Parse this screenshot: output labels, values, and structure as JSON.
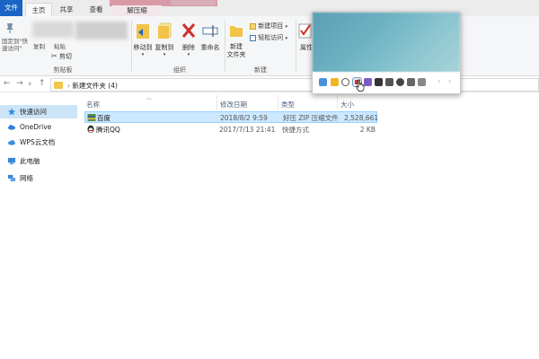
{
  "tabs": {
    "file": "文件",
    "home": "主页",
    "share": "共享",
    "view": "查看",
    "extract": "解压缩"
  },
  "ribbon": {
    "pin_label": "固定到\"快速访问\"",
    "copy_label": "复制",
    "paste_label": "粘贴",
    "cut_label": "剪切",
    "clipboard_group": "剪贴板",
    "move_to": "移动到",
    "copy_to": "复制到",
    "delete": "删除",
    "rename": "重命名",
    "organize_group": "组织",
    "new_folder": "新建\n文件夹",
    "new_item": "新建项目",
    "easy_access": "轻松访问",
    "new_group": "新建",
    "properties": "属性"
  },
  "address": {
    "path": "新建文件夹 (4)"
  },
  "nav_pane": {
    "items": [
      {
        "label": "快速访问",
        "icon": "star-icon"
      },
      {
        "label": "OneDrive",
        "icon": "cloud-icon"
      },
      {
        "label": "WPS云文档",
        "icon": "cloud-doc-icon"
      },
      {
        "label": "此电脑",
        "icon": "computer-icon"
      },
      {
        "label": "网络",
        "icon": "network-icon"
      }
    ]
  },
  "columns": {
    "name": "名称",
    "date": "修改日期",
    "type": "类型",
    "size": "大小"
  },
  "files": [
    {
      "name": "百度",
      "date": "2018/8/2 9:59",
      "type": "好压 ZIP 压缩文件",
      "size": "2,528,661",
      "icon": "zip-archive-icon"
    },
    {
      "name": "腾讯QQ",
      "date": "2017/7/13 21:41",
      "type": "快捷方式",
      "size": "2 KB",
      "icon": "qq-penguin-icon"
    }
  ],
  "colors": {
    "accent": "#1a64c6",
    "selection": "#cce8ff",
    "nav_selected": "#cce4f7"
  }
}
